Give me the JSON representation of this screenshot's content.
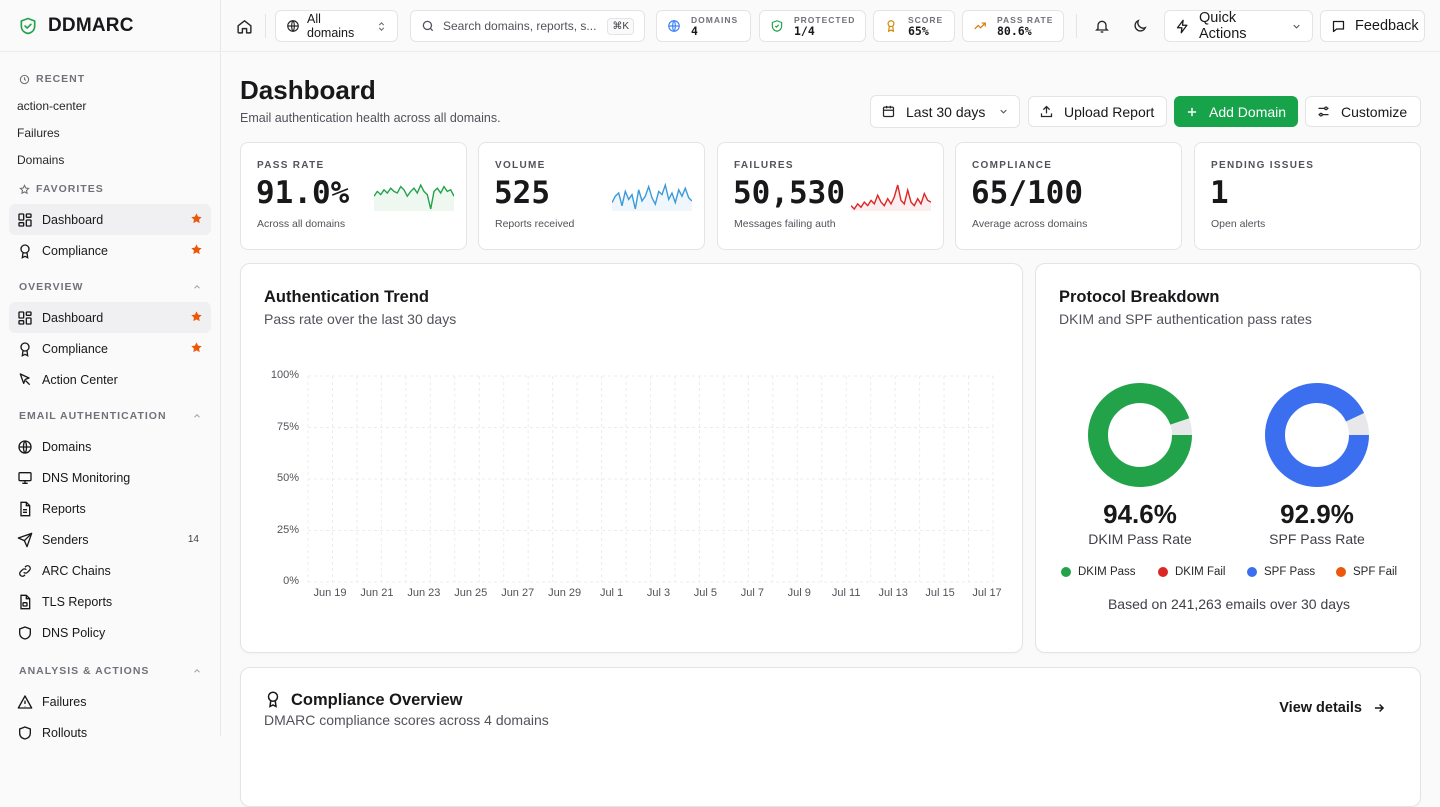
{
  "brand": {
    "name": "DDMARC"
  },
  "sidebar": {
    "recent_title": "RECENT",
    "recent": [
      "action-center",
      "Failures",
      "Domains"
    ],
    "favorites_title": "FAVORITES",
    "favorites": [
      {
        "label": "Dashboard",
        "icon": "dashboard-icon",
        "active": true
      },
      {
        "label": "Compliance",
        "icon": "badge-icon"
      }
    ],
    "overview_title": "OVERVIEW",
    "overview": [
      {
        "label": "Dashboard",
        "icon": "dashboard-icon",
        "active": true
      },
      {
        "label": "Compliance",
        "icon": "badge-icon"
      },
      {
        "label": "Action Center",
        "icon": "pointer-icon"
      }
    ],
    "email_title": "EMAIL AUTHENTICATION",
    "email": [
      {
        "label": "Domains",
        "icon": "globe-icon"
      },
      {
        "label": "DNS Monitoring",
        "icon": "monitor-icon"
      },
      {
        "label": "Reports",
        "icon": "file-icon"
      },
      {
        "label": "Senders",
        "icon": "send-icon",
        "count": "14"
      },
      {
        "label": "ARC Chains",
        "icon": "chain-icon"
      },
      {
        "label": "TLS Reports",
        "icon": "file-lock-icon"
      },
      {
        "label": "DNS Policy",
        "icon": "shield-icon"
      }
    ],
    "analysis_title": "ANALYSIS & ACTIONS",
    "analysis": [
      {
        "label": "Failures",
        "icon": "alert-triangle-icon"
      },
      {
        "label": "Rollouts",
        "icon": "shield-icon"
      }
    ]
  },
  "topbar": {
    "domain_select": "All domains",
    "search_placeholder": "Search domains, reports, s...",
    "search_shortcut": "⌘K",
    "stats": [
      {
        "label": "DOMAINS",
        "value": "4"
      },
      {
        "label": "PROTECTED",
        "value": "1/4"
      },
      {
        "label": "SCORE",
        "value": "65%"
      },
      {
        "label": "PASS RATE",
        "value": "80.6%"
      }
    ],
    "quick_actions": "Quick Actions",
    "feedback": "Feedback"
  },
  "page": {
    "title": "Dashboard",
    "subtitle": "Email authentication health across all domains.",
    "range": "Last 30 days",
    "upload": "Upload Report",
    "add_domain": "Add Domain",
    "customize": "Customize"
  },
  "kpis": [
    {
      "label": "PASS RATE",
      "value": "91.0%",
      "sub": "Across all domains",
      "color": "#22a34a",
      "spark": [
        12,
        9,
        11,
        8,
        10,
        7,
        9,
        10,
        6,
        8,
        12,
        9,
        7,
        10,
        5,
        9,
        11,
        20,
        9,
        7,
        10,
        6,
        9,
        8,
        12
      ]
    },
    {
      "label": "VOLUME",
      "value": "525",
      "sub": "Reports received",
      "color": "#3b9ad9",
      "spark": [
        16,
        12,
        10,
        18,
        9,
        14,
        11,
        20,
        8,
        15,
        12,
        6,
        13,
        17,
        9,
        11,
        5,
        14,
        10,
        16,
        8,
        12,
        7,
        13,
        15
      ]
    },
    {
      "label": "FAILURES",
      "value": "50,530",
      "sub": "Messages failing auth",
      "color": "#dc2626",
      "spark": [
        18,
        20,
        17,
        19,
        16,
        18,
        15,
        17,
        12,
        16,
        18,
        14,
        17,
        13,
        6,
        15,
        17,
        9,
        16,
        18,
        14,
        17,
        11,
        15,
        16
      ]
    },
    {
      "label": "COMPLIANCE",
      "value": "65/100",
      "sub": "Average across domains"
    },
    {
      "label": "PENDING ISSUES",
      "value": "1",
      "sub": "Open alerts"
    }
  ],
  "trend": {
    "title": "Authentication Trend",
    "subtitle": "Pass rate over the last 30 days"
  },
  "chart_data": {
    "type": "line",
    "title": "Authentication Trend",
    "x": [
      "Jun 19",
      "Jun 21",
      "Jun 23",
      "Jun 25",
      "Jun 27",
      "Jun 29",
      "Jul 1",
      "Jul 3",
      "Jul 5",
      "Jul 7",
      "Jul 9",
      "Jul 11",
      "Jul 13",
      "Jul 15",
      "Jul 17"
    ],
    "y_ticks": [
      "100%",
      "75%",
      "50%",
      "25%",
      "0%"
    ],
    "ylim": [
      0,
      100
    ],
    "grid": true,
    "series": []
  },
  "protocol": {
    "title": "Protocol Breakdown",
    "subtitle": "DKIM and SPF authentication pass rates",
    "dkim_rate": 94.6,
    "dkim_value": "94.6%",
    "dkim_label": "DKIM Pass Rate",
    "spf_rate": 92.9,
    "spf_value": "92.9%",
    "spf_label": "SPF Pass Rate",
    "legend": [
      {
        "label": "DKIM Pass",
        "color": "#22a34a"
      },
      {
        "label": "DKIM Fail",
        "color": "#dc2626"
      },
      {
        "label": "SPF Pass",
        "color": "#3b6ff0"
      },
      {
        "label": "SPF Fail",
        "color": "#ea580c"
      }
    ],
    "footnote": "Based on 241,263 emails over 30 days"
  },
  "compliance": {
    "title": "Compliance Overview",
    "subtitle": "DMARC compliance scores across 4 domains",
    "view_details": "View details"
  }
}
